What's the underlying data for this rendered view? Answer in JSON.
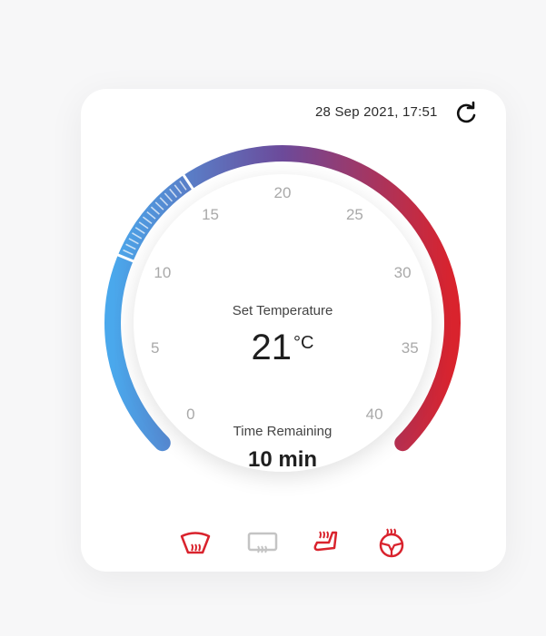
{
  "header": {
    "datetime": "28 Sep 2021, 17:51",
    "refresh_icon": "refresh-icon"
  },
  "dial": {
    "ticks": [
      "0",
      "5",
      "10",
      "15",
      "20",
      "25",
      "30",
      "35",
      "40"
    ],
    "set_label": "Set Temperature",
    "set_value": "21",
    "set_unit": "°C",
    "time_label": "Time Remaining",
    "time_value": "10 min",
    "range": [
      0,
      40
    ],
    "selected_range": [
      10,
      15
    ],
    "gradient": [
      "#4aa8ec",
      "#6c4a9a",
      "#d9232d"
    ]
  },
  "controls": [
    {
      "name": "windshield-defrost-icon",
      "active": true
    },
    {
      "name": "rear-window-defrost-icon",
      "active": false
    },
    {
      "name": "seat-heat-icon",
      "active": true
    },
    {
      "name": "steering-wheel-heat-icon",
      "active": true
    }
  ],
  "colors": {
    "accent": "#d9232d",
    "inactive": "#c4c4c4"
  }
}
